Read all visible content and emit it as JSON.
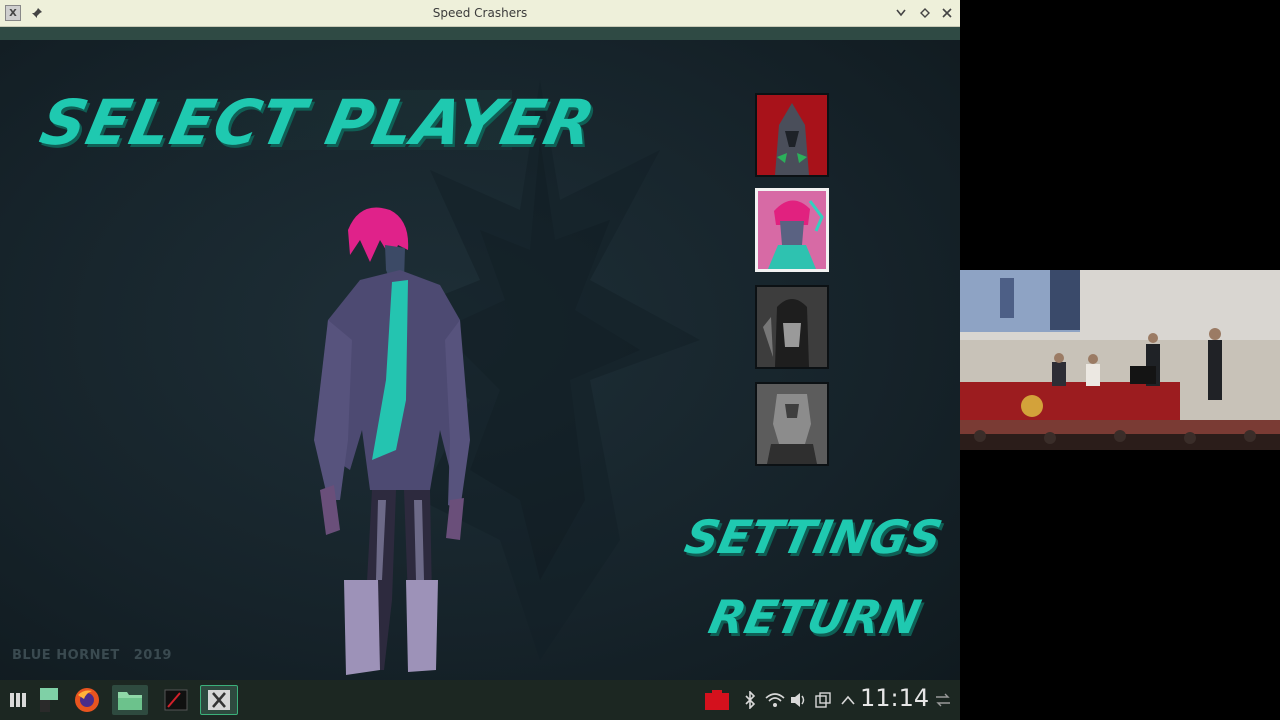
{
  "window": {
    "title": "Speed Crashers"
  },
  "game": {
    "heading": "SELECT PLAYER",
    "menu": {
      "settings": "SETTINGS",
      "return": "RETURN"
    },
    "credit": {
      "studio": "BLUE HORNET",
      "year": "2019"
    },
    "portraits": [
      {
        "name": "portrait-1",
        "selected": false
      },
      {
        "name": "portrait-2",
        "selected": true
      },
      {
        "name": "portrait-3",
        "selected": false
      },
      {
        "name": "portrait-4",
        "selected": false
      }
    ]
  },
  "taskbar": {
    "clock": "11:14"
  },
  "colors": {
    "accent": "#1fc9b0",
    "game_bg": "#17242a",
    "taskbar": "#1c2722",
    "titlebar": "#eef0da"
  }
}
